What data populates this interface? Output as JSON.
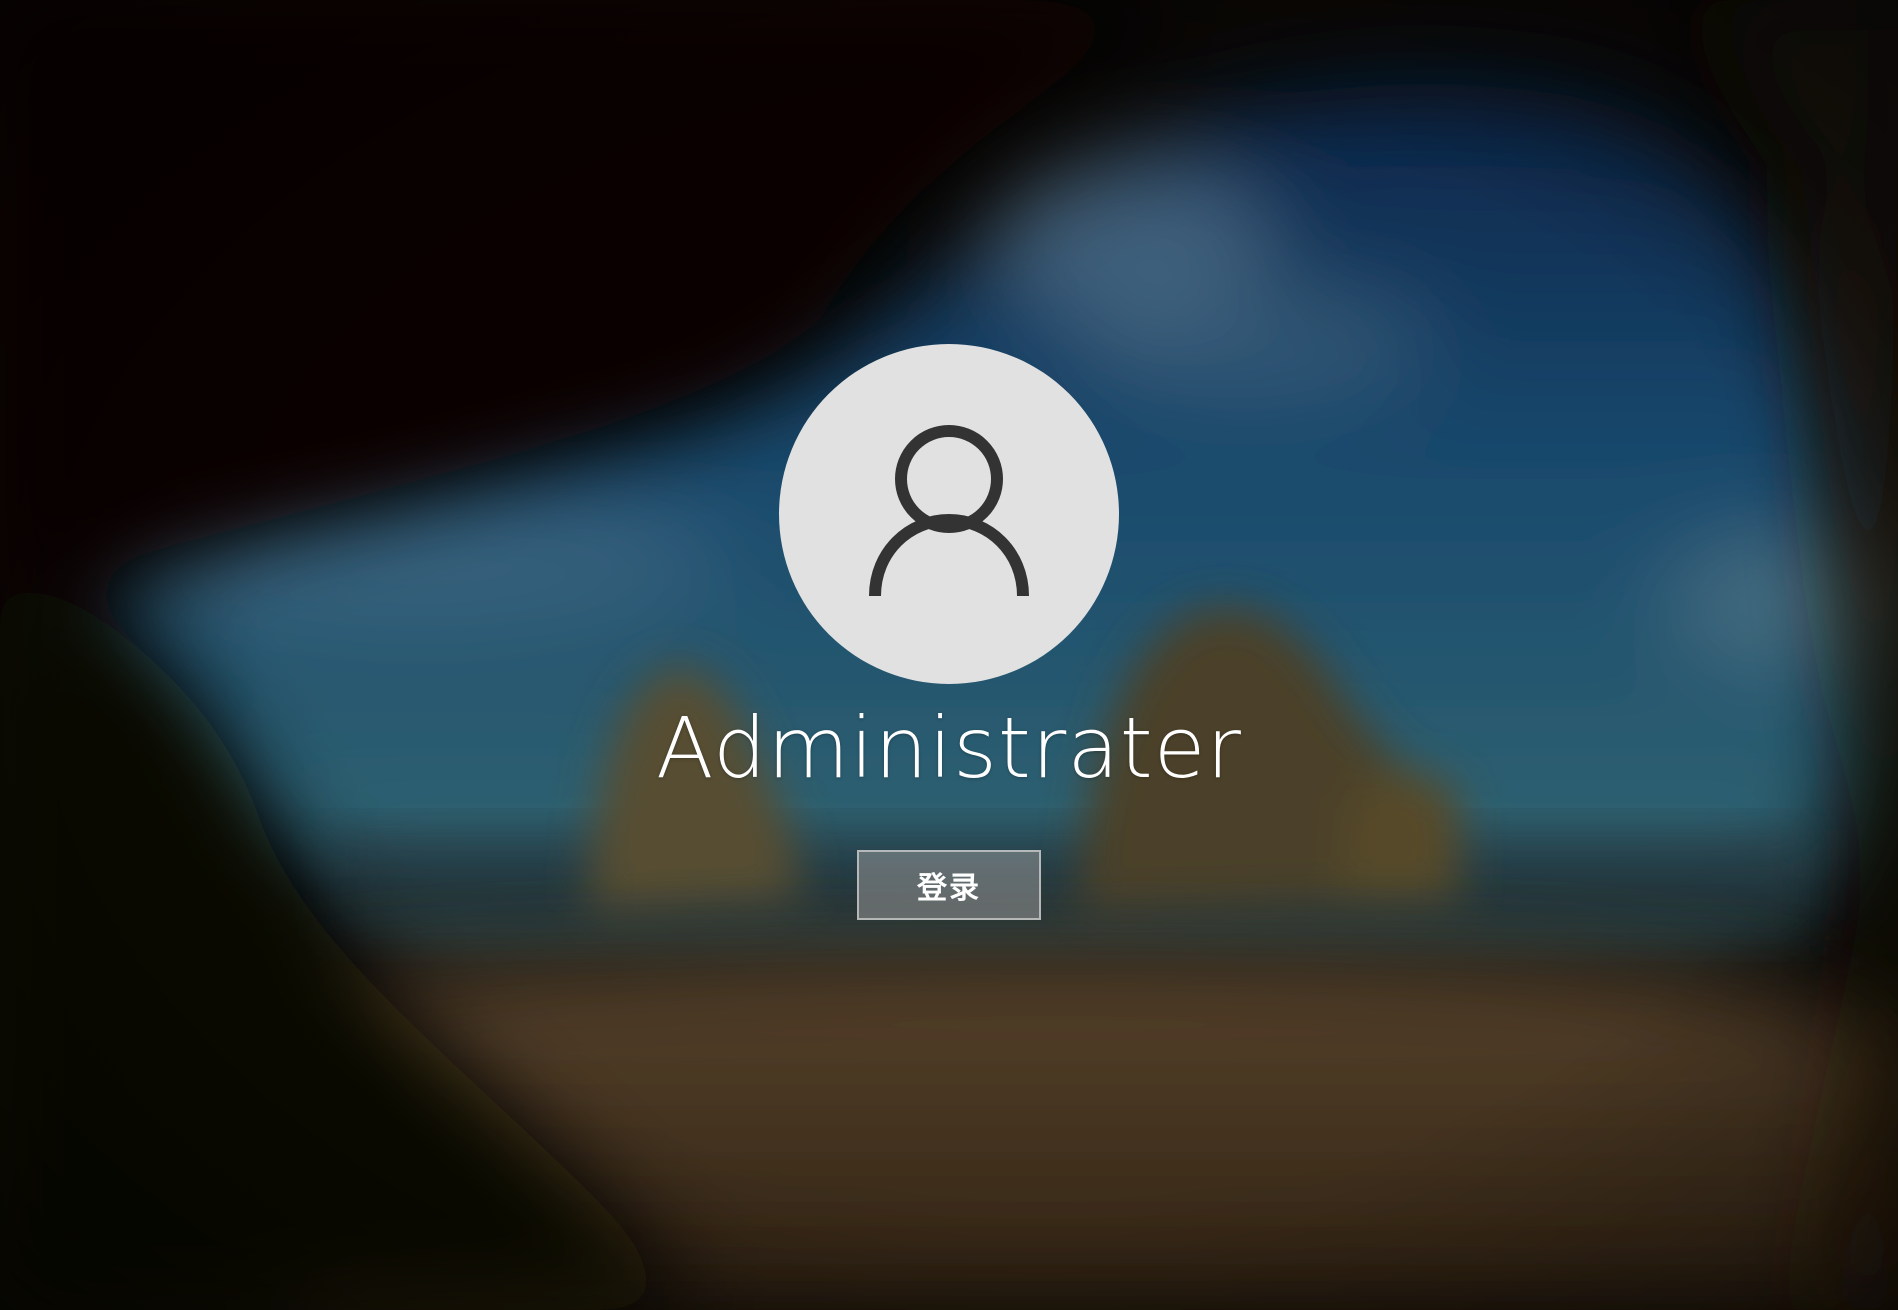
{
  "login": {
    "username": "Administrater",
    "signin_label": "登录"
  },
  "icons": {
    "avatar": "user-silhouette-icon"
  },
  "colors": {
    "avatar_background": "#e1e1e1",
    "avatar_glyph": "#333333",
    "text": "#ffffff",
    "button_background": "rgba(150,150,150,0.55)",
    "button_border": "rgba(210,210,210,0.75)"
  }
}
